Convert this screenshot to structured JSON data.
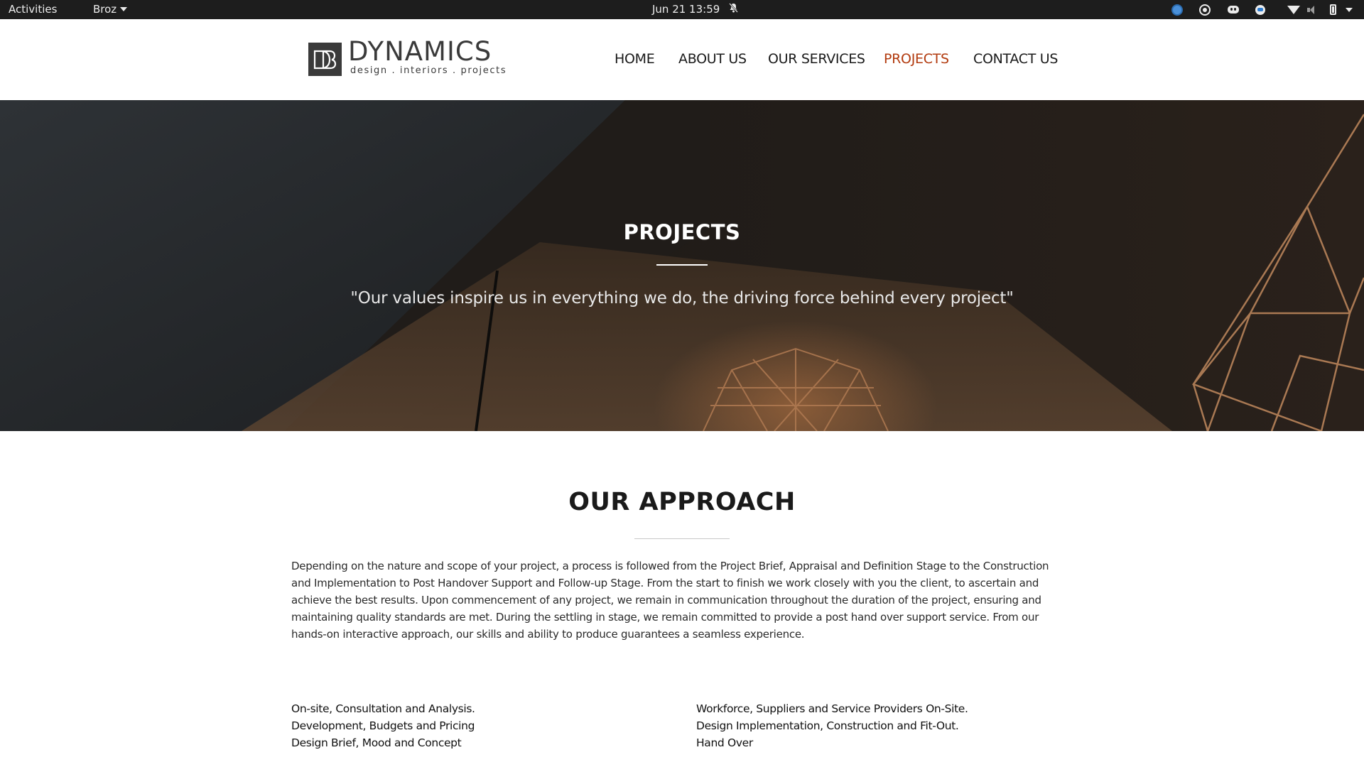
{
  "system_bar": {
    "activities": "Activities",
    "app_name": "Broz",
    "clock": "Jun 21  13:59",
    "tray_icons": [
      "chrome-icon",
      "obs-icon",
      "discord-icon",
      "signal-icon",
      "wifi-icon",
      "volume-muted-icon",
      "battery-icon",
      "system-menu-icon"
    ]
  },
  "header": {
    "logo": {
      "mark": "DB",
      "name": "DYNAMICS",
      "tagline": "design . interiors . projects"
    },
    "nav": {
      "home": "HOME",
      "about": "ABOUT US",
      "services": "OUR SERVICES",
      "projects": "PROJECTS",
      "contact": "CONTACT US",
      "active": "PROJECTS"
    }
  },
  "hero": {
    "title": "PROJECTS",
    "quote": "\"Our values inspire us in everything we do, the driving force behind every project\""
  },
  "approach": {
    "title": "OUR APPROACH",
    "body": "Depending on the nature and scope of your project, a process is followed from the Project Brief, Appraisal and Definition Stage to the Construction and Implementation to Post Handover Support and Follow-up Stage. From the start to finish we work closely with you the client, to ascertain and achieve the best results. Upon commencement of any project, we remain in communication throughout the duration of the project, ensuring and maintaining quality standards are met. During the settling in stage, we remain committed to provide a post hand over support service. From our hands-on interactive approach, our skills and ability to produce guarantees a seamless experience.",
    "steps_left": [
      "On-site, Consultation and Analysis.",
      "Development, Budgets and Pricing",
      "Design Brief, Mood and Concept"
    ],
    "steps_right": [
      "Workforce, Suppliers and Service Providers On-Site.",
      "Design Implementation, Construction and Fit-Out.",
      "Hand Over"
    ]
  },
  "colors": {
    "accent": "#b23a0e",
    "topbar": "#1d1d1d",
    "text": "#1a1a1a",
    "logo": "#3a3a3a"
  }
}
